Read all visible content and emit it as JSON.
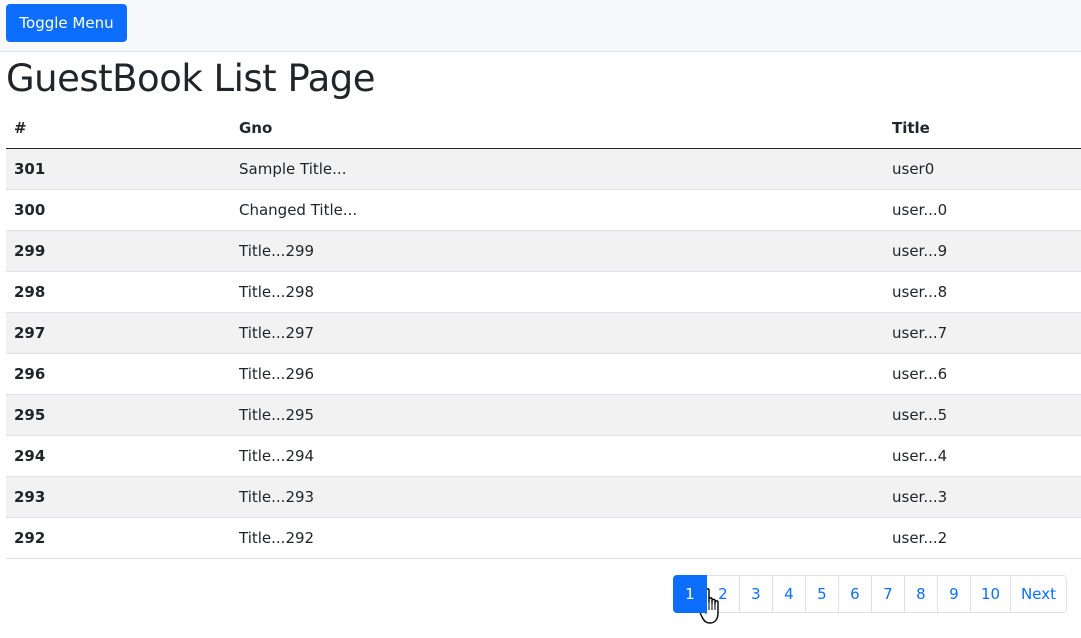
{
  "navbar": {
    "toggle_label": "Toggle Menu"
  },
  "page": {
    "title": "GuestBook List Page"
  },
  "table": {
    "headers": [
      "#",
      "Gno",
      "Title"
    ],
    "rows": [
      [
        "301",
        "Sample Title...",
        "user0"
      ],
      [
        "300",
        "Changed Title...",
        "user...0"
      ],
      [
        "299",
        "Title...299",
        "user...9"
      ],
      [
        "298",
        "Title...298",
        "user...8"
      ],
      [
        "297",
        "Title...297",
        "user...7"
      ],
      [
        "296",
        "Title...296",
        "user...6"
      ],
      [
        "295",
        "Title...295",
        "user...5"
      ],
      [
        "294",
        "Title...294",
        "user...4"
      ],
      [
        "293",
        "Title...293",
        "user...3"
      ],
      [
        "292",
        "Title...292",
        "user...2"
      ]
    ]
  },
  "pagination": {
    "pages": [
      "1",
      "2",
      "3",
      "4",
      "5",
      "6",
      "7",
      "8",
      "9",
      "10"
    ],
    "active": "1",
    "next_label": "Next"
  },
  "colors": {
    "primary": "#0d6efd",
    "striped_row": "#f2f2f2",
    "navbar_bg": "#f8f9fa"
  }
}
